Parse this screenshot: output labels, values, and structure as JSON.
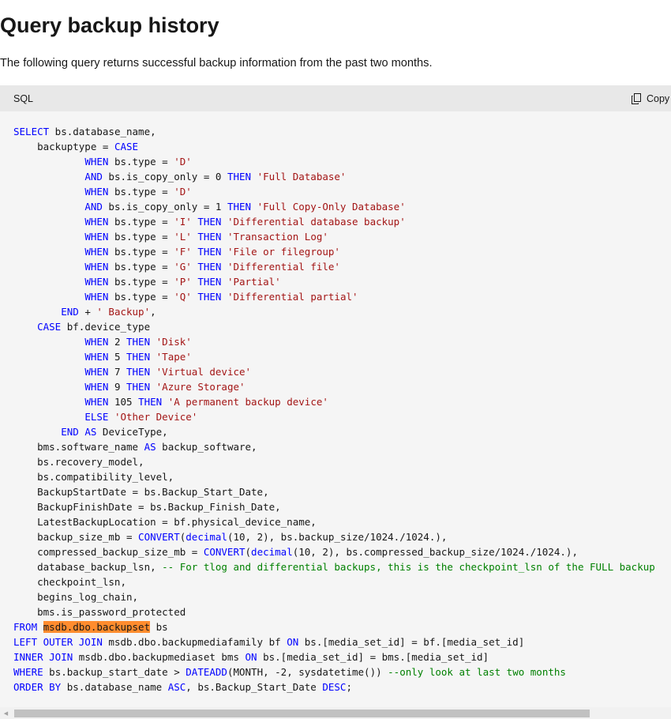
{
  "page": {
    "title": "Query backup history",
    "intro": "The following query returns successful backup information from the past two months."
  },
  "code_block": {
    "language": "SQL",
    "copy_label": "Copy",
    "copy_icon": "copy-icon",
    "colors": {
      "background": "#f5f5f5",
      "header_background": "#e8e8e8",
      "keyword": "#0000ff",
      "string": "#a31515",
      "comment": "#008000",
      "search_highlight": "#ff8c2e"
    },
    "lines": [
      [
        {
          "t": "kw",
          "v": "SELECT"
        },
        {
          "t": "tx",
          "v": " bs.database_name,"
        }
      ],
      [
        {
          "t": "tx",
          "v": "    backuptype = "
        },
        {
          "t": "kw",
          "v": "CASE"
        }
      ],
      [
        {
          "t": "tx",
          "v": "            "
        },
        {
          "t": "kw",
          "v": "WHEN"
        },
        {
          "t": "tx",
          "v": " bs.type = "
        },
        {
          "t": "str",
          "v": "'D'"
        }
      ],
      [
        {
          "t": "tx",
          "v": "            "
        },
        {
          "t": "kw",
          "v": "AND"
        },
        {
          "t": "tx",
          "v": " bs.is_copy_only = 0 "
        },
        {
          "t": "kw",
          "v": "THEN"
        },
        {
          "t": "tx",
          "v": " "
        },
        {
          "t": "str",
          "v": "'Full Database'"
        }
      ],
      [
        {
          "t": "tx",
          "v": "            "
        },
        {
          "t": "kw",
          "v": "WHEN"
        },
        {
          "t": "tx",
          "v": " bs.type = "
        },
        {
          "t": "str",
          "v": "'D'"
        }
      ],
      [
        {
          "t": "tx",
          "v": "            "
        },
        {
          "t": "kw",
          "v": "AND"
        },
        {
          "t": "tx",
          "v": " bs.is_copy_only = 1 "
        },
        {
          "t": "kw",
          "v": "THEN"
        },
        {
          "t": "tx",
          "v": " "
        },
        {
          "t": "str",
          "v": "'Full Copy-Only Database'"
        }
      ],
      [
        {
          "t": "tx",
          "v": "            "
        },
        {
          "t": "kw",
          "v": "WHEN"
        },
        {
          "t": "tx",
          "v": " bs.type = "
        },
        {
          "t": "str",
          "v": "'I'"
        },
        {
          "t": "tx",
          "v": " "
        },
        {
          "t": "kw",
          "v": "THEN"
        },
        {
          "t": "tx",
          "v": " "
        },
        {
          "t": "str",
          "v": "'Differential database backup'"
        }
      ],
      [
        {
          "t": "tx",
          "v": "            "
        },
        {
          "t": "kw",
          "v": "WHEN"
        },
        {
          "t": "tx",
          "v": " bs.type = "
        },
        {
          "t": "str",
          "v": "'L'"
        },
        {
          "t": "tx",
          "v": " "
        },
        {
          "t": "kw",
          "v": "THEN"
        },
        {
          "t": "tx",
          "v": " "
        },
        {
          "t": "str",
          "v": "'Transaction Log'"
        }
      ],
      [
        {
          "t": "tx",
          "v": "            "
        },
        {
          "t": "kw",
          "v": "WHEN"
        },
        {
          "t": "tx",
          "v": " bs.type = "
        },
        {
          "t": "str",
          "v": "'F'"
        },
        {
          "t": "tx",
          "v": " "
        },
        {
          "t": "kw",
          "v": "THEN"
        },
        {
          "t": "tx",
          "v": " "
        },
        {
          "t": "str",
          "v": "'File or filegroup'"
        }
      ],
      [
        {
          "t": "tx",
          "v": "            "
        },
        {
          "t": "kw",
          "v": "WHEN"
        },
        {
          "t": "tx",
          "v": " bs.type = "
        },
        {
          "t": "str",
          "v": "'G'"
        },
        {
          "t": "tx",
          "v": " "
        },
        {
          "t": "kw",
          "v": "THEN"
        },
        {
          "t": "tx",
          "v": " "
        },
        {
          "t": "str",
          "v": "'Differential file'"
        }
      ],
      [
        {
          "t": "tx",
          "v": "            "
        },
        {
          "t": "kw",
          "v": "WHEN"
        },
        {
          "t": "tx",
          "v": " bs.type = "
        },
        {
          "t": "str",
          "v": "'P'"
        },
        {
          "t": "tx",
          "v": " "
        },
        {
          "t": "kw",
          "v": "THEN"
        },
        {
          "t": "tx",
          "v": " "
        },
        {
          "t": "str",
          "v": "'Partial'"
        }
      ],
      [
        {
          "t": "tx",
          "v": "            "
        },
        {
          "t": "kw",
          "v": "WHEN"
        },
        {
          "t": "tx",
          "v": " bs.type = "
        },
        {
          "t": "str",
          "v": "'Q'"
        },
        {
          "t": "tx",
          "v": " "
        },
        {
          "t": "kw",
          "v": "THEN"
        },
        {
          "t": "tx",
          "v": " "
        },
        {
          "t": "str",
          "v": "'Differential partial'"
        }
      ],
      [
        {
          "t": "tx",
          "v": "        "
        },
        {
          "t": "kw",
          "v": "END"
        },
        {
          "t": "tx",
          "v": " + "
        },
        {
          "t": "str",
          "v": "' Backup'"
        },
        {
          "t": "tx",
          "v": ","
        }
      ],
      [
        {
          "t": "tx",
          "v": "    "
        },
        {
          "t": "kw",
          "v": "CASE"
        },
        {
          "t": "tx",
          "v": " bf.device_type"
        }
      ],
      [
        {
          "t": "tx",
          "v": "            "
        },
        {
          "t": "kw",
          "v": "WHEN"
        },
        {
          "t": "tx",
          "v": " 2 "
        },
        {
          "t": "kw",
          "v": "THEN"
        },
        {
          "t": "tx",
          "v": " "
        },
        {
          "t": "str",
          "v": "'Disk'"
        }
      ],
      [
        {
          "t": "tx",
          "v": "            "
        },
        {
          "t": "kw",
          "v": "WHEN"
        },
        {
          "t": "tx",
          "v": " 5 "
        },
        {
          "t": "kw",
          "v": "THEN"
        },
        {
          "t": "tx",
          "v": " "
        },
        {
          "t": "str",
          "v": "'Tape'"
        }
      ],
      [
        {
          "t": "tx",
          "v": "            "
        },
        {
          "t": "kw",
          "v": "WHEN"
        },
        {
          "t": "tx",
          "v": " 7 "
        },
        {
          "t": "kw",
          "v": "THEN"
        },
        {
          "t": "tx",
          "v": " "
        },
        {
          "t": "str",
          "v": "'Virtual device'"
        }
      ],
      [
        {
          "t": "tx",
          "v": "            "
        },
        {
          "t": "kw",
          "v": "WHEN"
        },
        {
          "t": "tx",
          "v": " 9 "
        },
        {
          "t": "kw",
          "v": "THEN"
        },
        {
          "t": "tx",
          "v": " "
        },
        {
          "t": "str",
          "v": "'Azure Storage'"
        }
      ],
      [
        {
          "t": "tx",
          "v": "            "
        },
        {
          "t": "kw",
          "v": "WHEN"
        },
        {
          "t": "tx",
          "v": " 105 "
        },
        {
          "t": "kw",
          "v": "THEN"
        },
        {
          "t": "tx",
          "v": " "
        },
        {
          "t": "str",
          "v": "'A permanent backup device'"
        }
      ],
      [
        {
          "t": "tx",
          "v": "            "
        },
        {
          "t": "kw",
          "v": "ELSE"
        },
        {
          "t": "tx",
          "v": " "
        },
        {
          "t": "str",
          "v": "'Other Device'"
        }
      ],
      [
        {
          "t": "tx",
          "v": "        "
        },
        {
          "t": "kw",
          "v": "END"
        },
        {
          "t": "tx",
          "v": " "
        },
        {
          "t": "kw",
          "v": "AS"
        },
        {
          "t": "tx",
          "v": " DeviceType,"
        }
      ],
      [
        {
          "t": "tx",
          "v": "    bms.software_name "
        },
        {
          "t": "kw",
          "v": "AS"
        },
        {
          "t": "tx",
          "v": " backup_software,"
        }
      ],
      [
        {
          "t": "tx",
          "v": "    bs.recovery_model,"
        }
      ],
      [
        {
          "t": "tx",
          "v": "    bs.compatibility_level,"
        }
      ],
      [
        {
          "t": "tx",
          "v": "    BackupStartDate = bs.Backup_Start_Date,"
        }
      ],
      [
        {
          "t": "tx",
          "v": "    BackupFinishDate = bs.Backup_Finish_Date,"
        }
      ],
      [
        {
          "t": "tx",
          "v": "    LatestBackupLocation = bf.physical_device_name,"
        }
      ],
      [
        {
          "t": "tx",
          "v": "    backup_size_mb = "
        },
        {
          "t": "kw",
          "v": "CONVERT"
        },
        {
          "t": "tx",
          "v": "("
        },
        {
          "t": "kw",
          "v": "decimal"
        },
        {
          "t": "tx",
          "v": "(10, 2), bs.backup_size/1024./1024.),"
        }
      ],
      [
        {
          "t": "tx",
          "v": "    compressed_backup_size_mb = "
        },
        {
          "t": "kw",
          "v": "CONVERT"
        },
        {
          "t": "tx",
          "v": "("
        },
        {
          "t": "kw",
          "v": "decimal"
        },
        {
          "t": "tx",
          "v": "(10, 2), bs.compressed_backup_size/1024./1024.),"
        }
      ],
      [
        {
          "t": "tx",
          "v": "    database_backup_lsn, "
        },
        {
          "t": "cm",
          "v": "-- For tlog and differential backups, this is the checkpoint_lsn of the FULL backup"
        }
      ],
      [
        {
          "t": "tx",
          "v": "    checkpoint_lsn,"
        }
      ],
      [
        {
          "t": "tx",
          "v": "    begins_log_chain,"
        }
      ],
      [
        {
          "t": "tx",
          "v": "    bms.is_password_protected"
        }
      ],
      [
        {
          "t": "kw",
          "v": "FROM"
        },
        {
          "t": "tx",
          "v": " "
        },
        {
          "t": "hl",
          "v": "msdb.dbo.backupset"
        },
        {
          "t": "tx",
          "v": " bs"
        }
      ],
      [
        {
          "t": "kw",
          "v": "LEFT OUTER JOIN"
        },
        {
          "t": "tx",
          "v": " msdb.dbo.backupmediafamily bf "
        },
        {
          "t": "kw",
          "v": "ON"
        },
        {
          "t": "tx",
          "v": " bs.[media_set_id] = bf.[media_set_id]"
        }
      ],
      [
        {
          "t": "kw",
          "v": "INNER JOIN"
        },
        {
          "t": "tx",
          "v": " msdb.dbo.backupmediaset bms "
        },
        {
          "t": "kw",
          "v": "ON"
        },
        {
          "t": "tx",
          "v": " bs.[media_set_id] = bms.[media_set_id]"
        }
      ],
      [
        {
          "t": "kw",
          "v": "WHERE"
        },
        {
          "t": "tx",
          "v": " bs.backup_start_date > "
        },
        {
          "t": "kw",
          "v": "DATEADD"
        },
        {
          "t": "tx",
          "v": "(MONTH, -2, sysdatetime()) "
        },
        {
          "t": "cm",
          "v": "--only look at last two months"
        }
      ],
      [
        {
          "t": "kw",
          "v": "ORDER BY"
        },
        {
          "t": "tx",
          "v": " bs.database_name "
        },
        {
          "t": "kw",
          "v": "ASC"
        },
        {
          "t": "tx",
          "v": ", bs.Backup_Start_Date "
        },
        {
          "t": "kw",
          "v": "DESC"
        },
        {
          "t": "tx",
          "v": ";"
        }
      ]
    ]
  },
  "scrollbar": {
    "orientation": "horizontal",
    "left_arrow_icon": "arrow-left-icon"
  }
}
